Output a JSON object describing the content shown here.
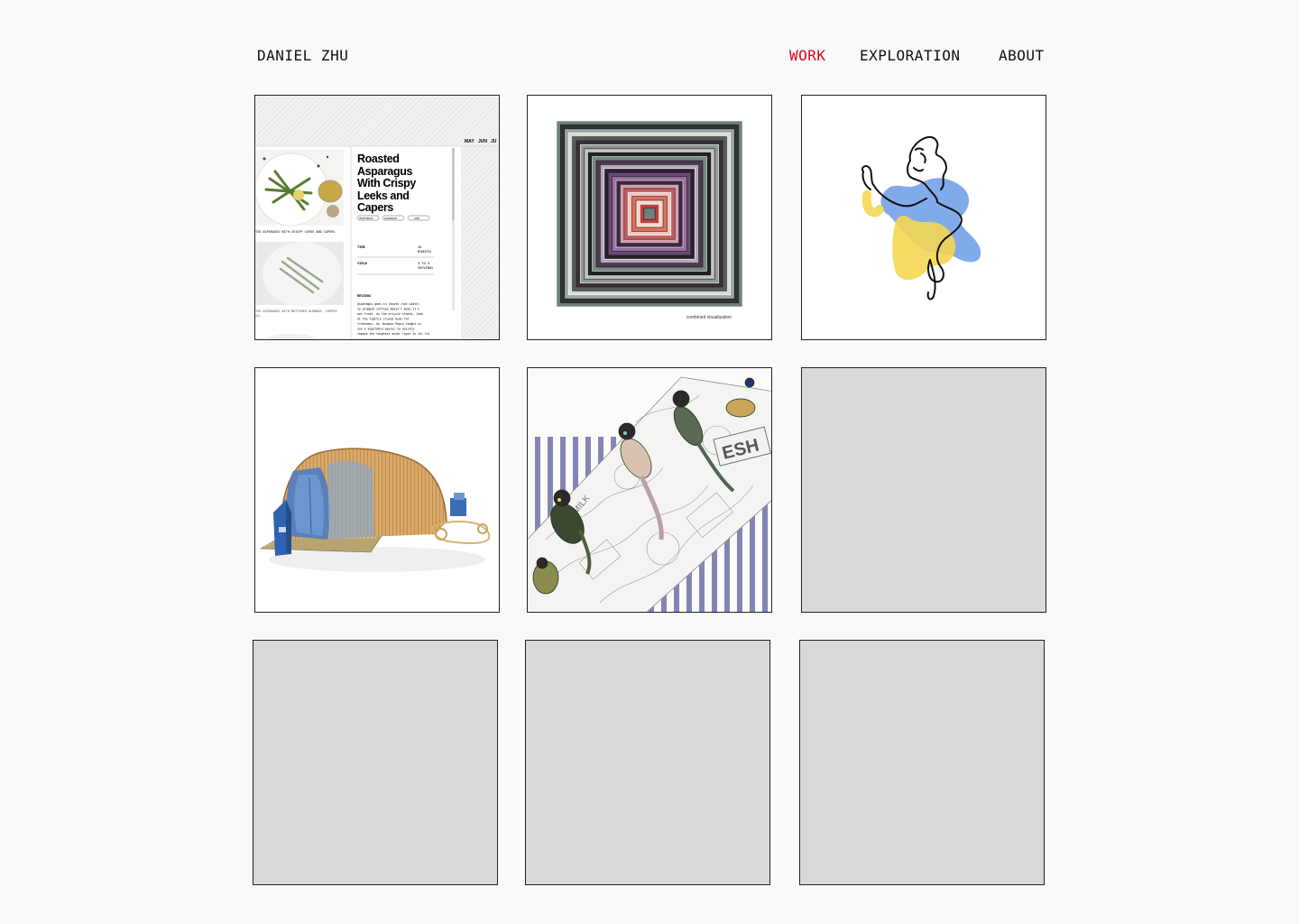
{
  "header": {
    "brand": "DANIEL ZHU",
    "nav": [
      {
        "label": "WORK",
        "active": true
      },
      {
        "label": "EXPLORATION",
        "active": false
      },
      {
        "label": "ABOUT",
        "active": false
      }
    ]
  },
  "colors": {
    "accent": "#e3001b",
    "background": "#f9f9f9",
    "placeholder": "#d9d9d9"
  },
  "recipe_preview": {
    "nav_items": [
      "MAY",
      "JUN",
      "JU"
    ],
    "close_glyph": "×",
    "title_lines": [
      "Roasted",
      "Asparagus",
      "With Crispy",
      "Leeks and",
      "Capers"
    ],
    "tags": [
      "VEGETABLES",
      "ASPARAGUS",
      "LEEK"
    ],
    "caption_1": "TED ASPARAGUS WITH CRISPY LEEKS AND CAPERS",
    "caption_2": "TED ASPARAGUS WITH BUTTERED ALMONDS, CAPERS",
    "caption_2b": "ILL",
    "time_label": "TIME",
    "time_value_1": "20",
    "time_value_2": "MINUTES",
    "yield_label": "YIELD",
    "yield_value_1": "3 TO 4",
    "yield_value_2": "SERVINGS",
    "reviews_label": "REVIEWS",
    "review_lines": [
      "Asparagus goes in length (not width)",
      "so plumped coffsee doesn't mean it's",
      "not fresh. As the article states, look",
      "at the tightly closed buds for",
      "freshness. As Jacques Pepin taught us",
      "use a vegetable peeler to quickly",
      "remove the toughest outer layer in Jul ful"
    ]
  },
  "visualization_caption": "combined visualization",
  "mock_labels": {
    "fresh": "ESH",
    "milk": "MILK"
  }
}
